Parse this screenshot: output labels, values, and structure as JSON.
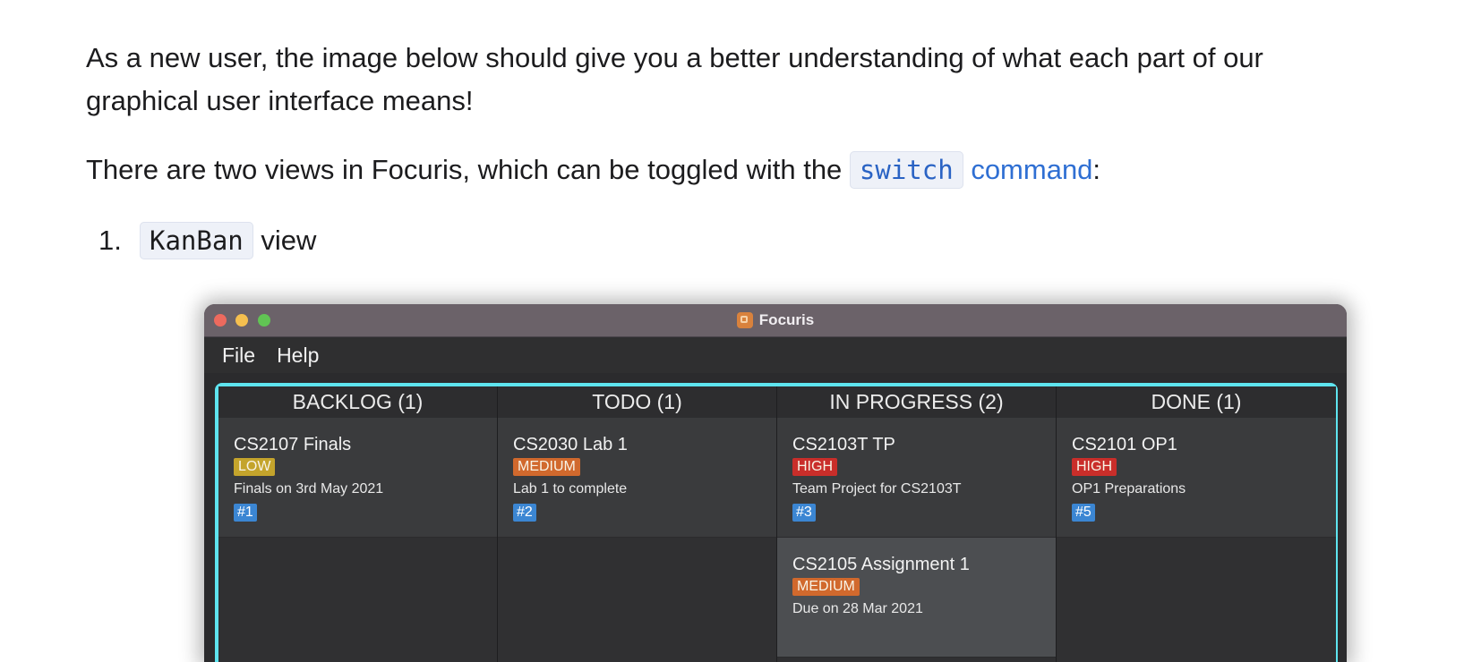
{
  "doc": {
    "p1": "As a new user, the image below should give you a better understanding of what each part of our graphical user interface means!",
    "p2_prefix": "There are two views in Focuris, which can be toggled with the",
    "p2_code": "switch",
    "p2_link": "command",
    "p2_suffix": ":",
    "list": [
      {
        "number": "1.",
        "code": "KanBan",
        "text": "view"
      }
    ]
  },
  "app": {
    "window_title": "Focuris",
    "menu": [
      "File",
      "Help"
    ],
    "columns": [
      {
        "header": "BACKLOG (1)",
        "cards": [
          {
            "title": "CS2107 Finals",
            "priority": "LOW",
            "description": "Finals on 3rd May 2021",
            "id": "#1"
          }
        ]
      },
      {
        "header": "TODO (1)",
        "cards": [
          {
            "title": "CS2030 Lab 1",
            "priority": "MEDIUM",
            "description": "Lab 1 to complete",
            "id": "#2"
          }
        ]
      },
      {
        "header": "IN PROGRESS (2)",
        "cards": [
          {
            "title": "CS2103T TP",
            "priority": "HIGH",
            "description": "Team Project for CS2103T",
            "id": "#3"
          },
          {
            "title": "CS2105 Assignment 1",
            "priority": "MEDIUM",
            "description": "Due on 28 Mar 2021"
          }
        ]
      },
      {
        "header": "DONE (1)",
        "cards": [
          {
            "title": "CS2101 OP1",
            "priority": "HIGH",
            "description": "OP1 Preparations",
            "id": "#5"
          }
        ]
      }
    ]
  },
  "colors": {
    "accent_border": "#5ee4ef",
    "link": "#2f6fd3",
    "priority_low": "#c4a42c",
    "priority_medium": "#d1692d",
    "priority_high": "#c92e2a",
    "id_badge": "#3b86d3"
  }
}
